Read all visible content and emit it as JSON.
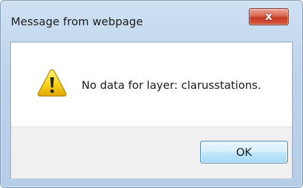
{
  "window": {
    "title": "Message from webpage",
    "close_label": "x"
  },
  "dialog": {
    "icon": "warning-icon",
    "message": "No data for layer: clarusstations.",
    "ok_label": "OK"
  },
  "colors": {
    "title_bar": "#bcd3ec",
    "close_button": "#c63a22",
    "button_area": "#f0f0f0",
    "ok_button_border": "#3c7fb1",
    "warning_yellow": "#f5c518"
  }
}
